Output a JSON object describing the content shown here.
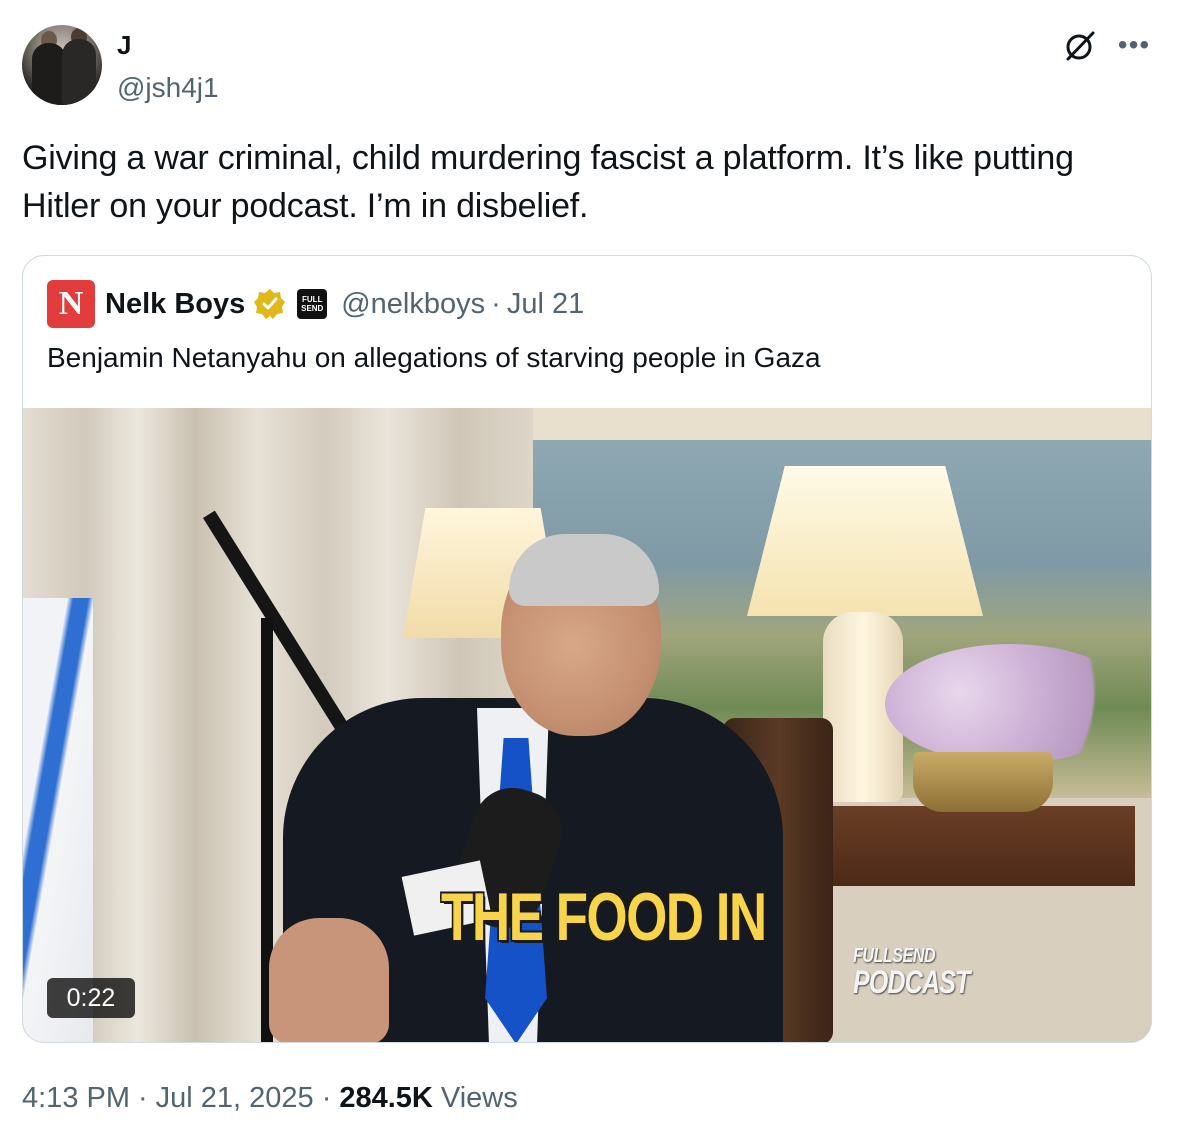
{
  "author": {
    "display_name": "J",
    "handle": "@jsh4j1"
  },
  "tweet": {
    "text": "Giving a war criminal, child murdering fascist a platform. It’s like putting Hitler on your podcast. I’m in disbelief."
  },
  "quoted": {
    "logo_letter": "N",
    "name": "Nelk Boys",
    "affiliate_badge": "FULL SEND",
    "handle": "@nelkboys",
    "date": "Jul 21",
    "text": "Benjamin Netanyahu on allegations of starving people in Gaza",
    "video": {
      "caption": "THE FOOD IN",
      "watermark_line1": "FULLSEND",
      "watermark_line2": "PODCAST",
      "duration": "0:22"
    }
  },
  "meta": {
    "time": "4:13 PM",
    "date": "Jul 21, 2025",
    "views_count": "284.5K",
    "views_label": "Views"
  },
  "colors": {
    "text_primary": "#0f1419",
    "text_secondary": "#536471",
    "border": "#cfd9de",
    "verified_gold": "#e2b719",
    "caption_yellow": "#f7d44a"
  },
  "icons": [
    "grok-icon",
    "more-icon",
    "verified-icon",
    "affiliate-icon"
  ]
}
